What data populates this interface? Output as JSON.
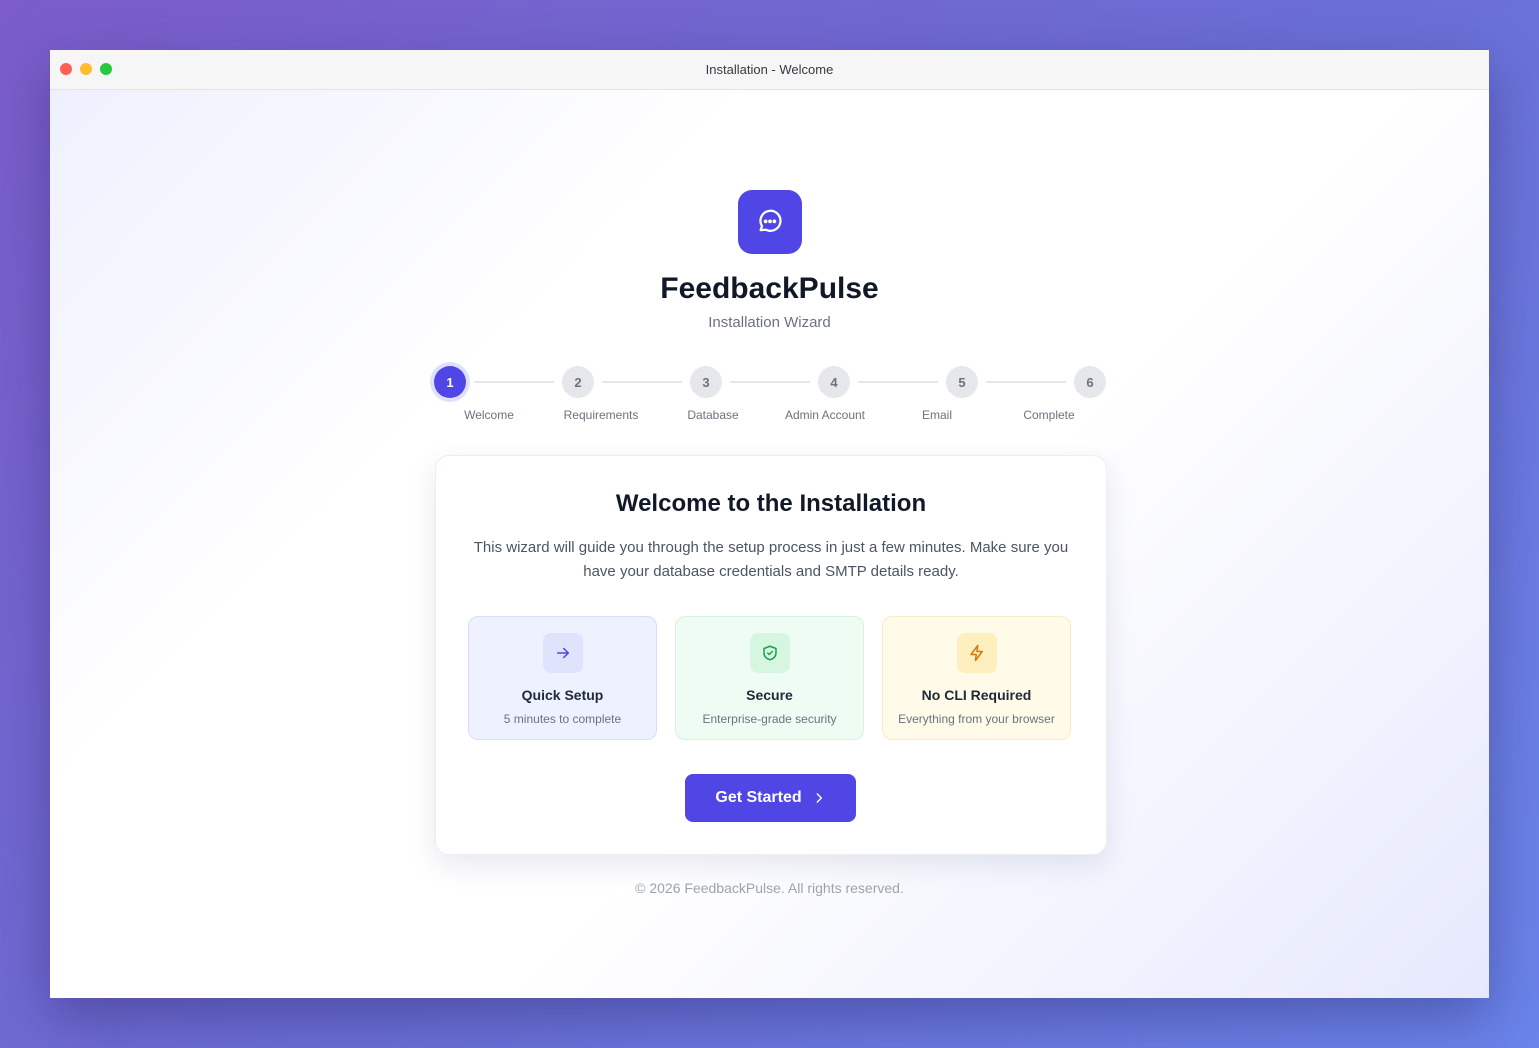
{
  "window": {
    "title": "Installation - Welcome"
  },
  "app": {
    "name": "FeedbackPulse",
    "subtitle": "Installation Wizard",
    "logo_icon": "chat-bubble-icon"
  },
  "steps": [
    {
      "number": "1",
      "label": "Welcome",
      "active": true
    },
    {
      "number": "2",
      "label": "Requirements",
      "active": false
    },
    {
      "number": "3",
      "label": "Database",
      "active": false
    },
    {
      "number": "4",
      "label": "Admin Account",
      "active": false
    },
    {
      "number": "5",
      "label": "Email",
      "active": false
    },
    {
      "number": "6",
      "label": "Complete",
      "active": false
    }
  ],
  "card": {
    "title": "Welcome to the Installation",
    "description": "This wizard will guide you through the setup process in just a few minutes. Make sure you have your database credentials and SMTP details ready.",
    "features": [
      {
        "title": "Quick Setup",
        "subtitle": "5 minutes to complete",
        "icon": "arrow-right-icon",
        "color": "#4f46e5"
      },
      {
        "title": "Secure",
        "subtitle": "Enterprise-grade security",
        "icon": "shield-check-icon",
        "color": "#16a34a"
      },
      {
        "title": "No CLI Required",
        "subtitle": "Everything from your browser",
        "icon": "lightning-icon",
        "color": "#d97706"
      }
    ],
    "button_label": "Get Started"
  },
  "footer": {
    "copyright": "© 2026 FeedbackPulse. All rights reserved."
  },
  "colors": {
    "accent": "#4f46e5",
    "text_dark": "#111827",
    "text_muted": "#6b7280"
  }
}
